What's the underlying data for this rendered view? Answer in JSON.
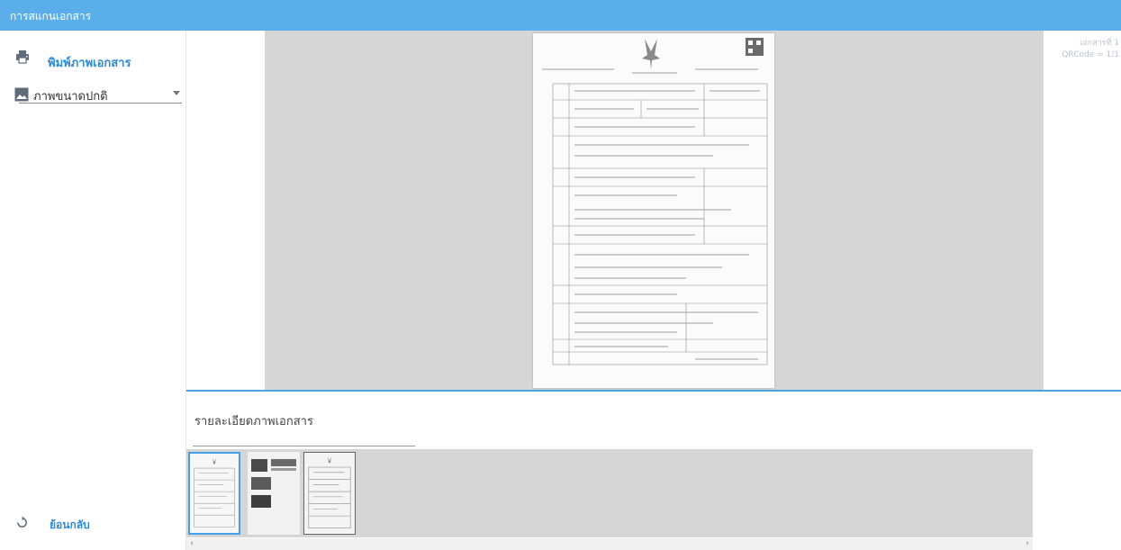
{
  "app": {
    "title": "การสแกนเอกสาร"
  },
  "sidebar": {
    "print_label": "พิมพ์ภาพเอกสาร",
    "size_select": {
      "selected": "ภาพขนาดปกติ"
    },
    "back_label": "ย้อนกลับ"
  },
  "preview": {
    "page_indicator": [
      "เอกสารที่ 1",
      "QRCode = 1/1"
    ]
  },
  "details": {
    "title": "รายละเอียดภาพเอกสาร"
  },
  "thumbnails": {
    "count": 3,
    "selected_index": 0
  },
  "colors": {
    "header": "#5aaee9",
    "accent": "#2d8ad6",
    "divider": "#4aa3e3",
    "preview_bg": "#d6d6d6"
  },
  "icons": [
    "printer-icon",
    "image-icon",
    "chevron-down-icon",
    "back-icon",
    "chevron-left-icon",
    "chevron-right-icon"
  ]
}
